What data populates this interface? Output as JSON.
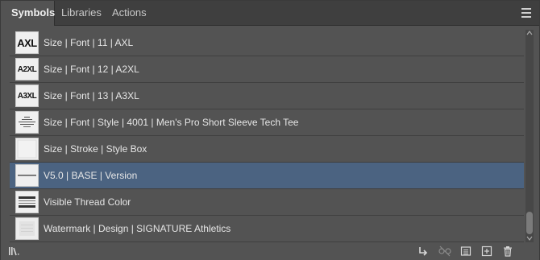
{
  "tabs": [
    {
      "label": "Symbols",
      "active": true
    },
    {
      "label": "Libraries",
      "active": false
    },
    {
      "label": "Actions",
      "active": false
    }
  ],
  "rows": [
    {
      "label": "Size | Font | 11 | AXL",
      "thumb": "AXL",
      "selected": false
    },
    {
      "label": "Size | Font | 12 | A2XL",
      "thumb": "A2XL",
      "selected": false
    },
    {
      "label": "Size | Font | 13 | A3XL",
      "thumb": "A3XL",
      "selected": false
    },
    {
      "label": "Size | Font | Style | 4001 | Men's Pro Short Sleeve Tech Tee",
      "thumb": "",
      "selected": false
    },
    {
      "label": "Size | Stroke | Style Box",
      "thumb": "",
      "selected": false
    },
    {
      "label": "V5.0 | BASE | Version",
      "thumb": "",
      "selected": true
    },
    {
      "label": "Visible Thread Color",
      "thumb": "",
      "selected": false
    },
    {
      "label": "Watermark | Design | SIGNATURE Athletics",
      "thumb": "",
      "selected": false
    }
  ],
  "colors": {
    "panel_bg": "#535353",
    "tabbar_bg": "#3f3f3f",
    "selected_row": "#4b6381",
    "text": "#e6e6e6"
  },
  "icons": {
    "panel_menu": "hamburger-menu-icon",
    "library_menu": "symbol-library-menu-icon",
    "place_instance": "place-symbol-instance-icon",
    "break_link": "break-link-icon",
    "symbol_options": "symbol-options-icon",
    "new_symbol": "new-symbol-icon",
    "delete": "trash-icon"
  }
}
